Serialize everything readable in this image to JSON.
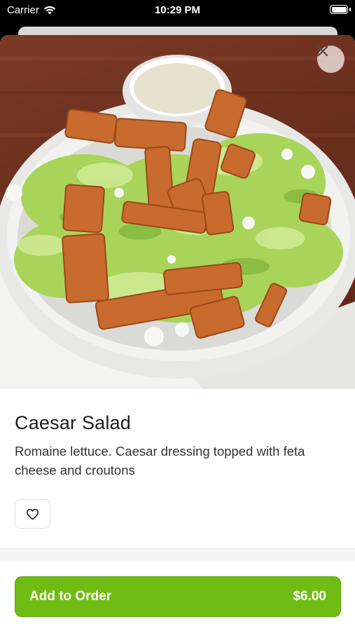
{
  "status_bar": {
    "carrier": "Carrier",
    "time": "10:29 PM"
  },
  "item": {
    "name": "Caesar Salad",
    "description": "Romaine lettuce. Caesar dressing topped with feta cheese and croutons",
    "image_icon": "caesar-salad-photo"
  },
  "actions": {
    "close_icon": "close-icon",
    "favorite_icon": "heart-icon",
    "add_to_order_label": "Add to Order",
    "price": "$6.00"
  },
  "colors": {
    "accent": "#6fbd12",
    "text": "#1d1d1d"
  }
}
